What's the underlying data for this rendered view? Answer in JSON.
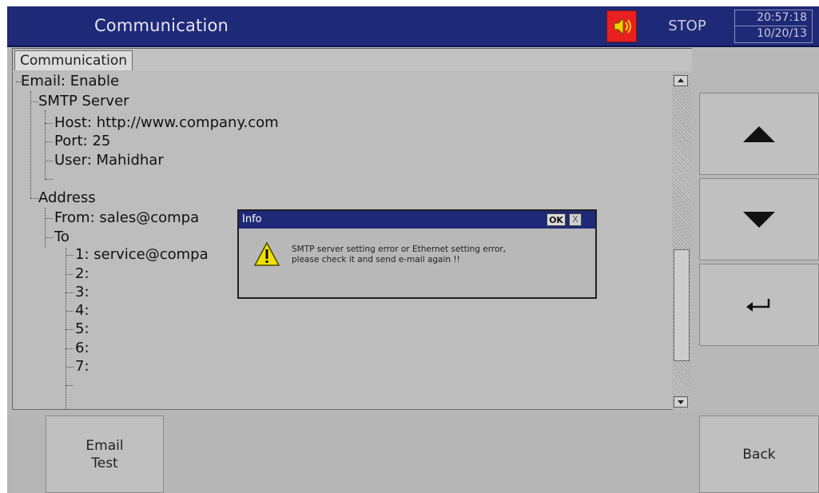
{
  "header": {
    "title": "Communication",
    "alarm_icon": "speaker-icon",
    "status": "STOP",
    "time": "20:57:18",
    "date": "10/20/13",
    "colors": {
      "bar": "#1e2a78",
      "alarm": "#e82020"
    }
  },
  "tabs": [
    {
      "label": "Communication"
    }
  ],
  "tree": {
    "email": "Email: Enable",
    "smtp": "SMTP Server",
    "host": "Host: http://www.company.com",
    "port": "Port: 25",
    "user": "User: Mahidhar",
    "address": "Address",
    "from": "From: sales@compa",
    "to": "To",
    "recipients": [
      "1: service@compa",
      "2:",
      "3:",
      "4:",
      "5:",
      "6:",
      "7:"
    ]
  },
  "dialog": {
    "title": "Info",
    "ok_label": "OK",
    "close_label": "X",
    "icon": "warning-icon",
    "message_line1": "SMTP server setting error or Ethernet setting error,",
    "message_line2": "please check it and send e-mail again !!"
  },
  "nav": {
    "up_icon": "arrow-up-icon",
    "down_icon": "arrow-down-icon",
    "enter_icon": "enter-icon"
  },
  "footer": {
    "email_test_line1": "Email",
    "email_test_line2": "Test",
    "back_label": "Back"
  }
}
